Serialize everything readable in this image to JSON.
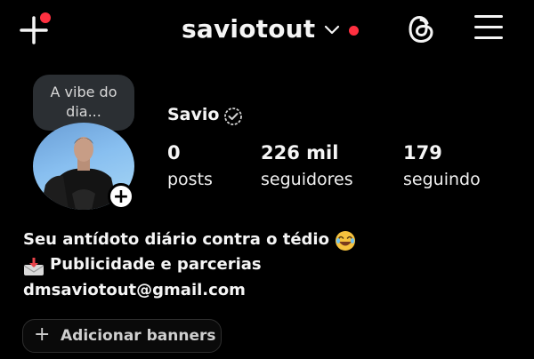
{
  "header": {
    "username": "saviotout",
    "colors": {
      "notification_dot": "#ff3040",
      "background": "#000000",
      "text": "#f5f5f5"
    },
    "icons": [
      "plus-icon",
      "chevron-down-icon",
      "threads-icon",
      "menu-icon"
    ]
  },
  "note": {
    "text": "A vibe do dia..."
  },
  "profile": {
    "display_name": "Savio",
    "verified_icon": "verified-badge-icon",
    "stats": [
      {
        "value": "0",
        "label": "posts"
      },
      {
        "value": "226 mil",
        "label": "seguidores"
      },
      {
        "value": "179",
        "label": "seguindo"
      }
    ]
  },
  "bio": {
    "line1": "Seu antídoto diário contra o tédio",
    "line1_emoji": "laughing-emoji",
    "line2_icon": "mail-inbox-icon",
    "line2": "Publicidade e parcerias",
    "line3": "dmsaviotout@gmail.com"
  },
  "actions": {
    "add_banners_label": "Adicionar banners"
  }
}
